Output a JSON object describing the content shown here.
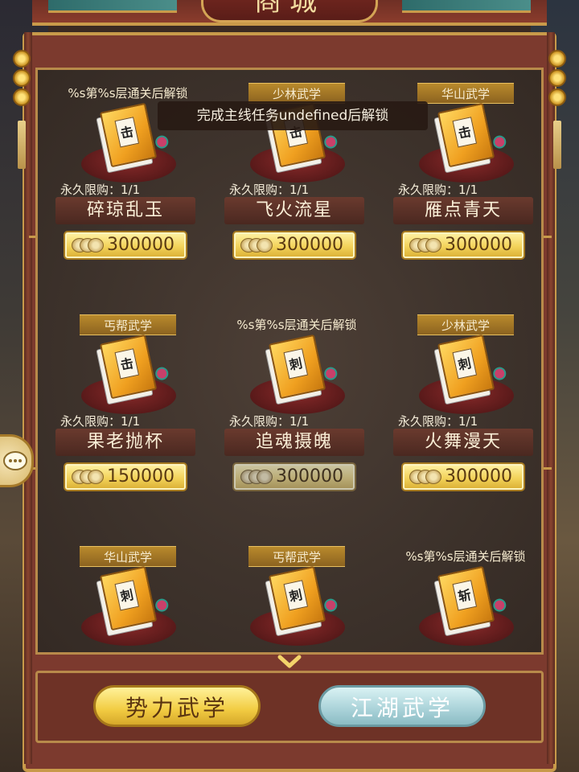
{
  "title": "商城",
  "tooltip": "完成主线任务undefined后解锁",
  "items": [
    {
      "tag": "%s第%s层通关后解锁",
      "tag_style": "plain",
      "book_char": "击",
      "limit": "永久限购：1/1",
      "name": "碎琼乱玉",
      "price": "300000",
      "price_active": true
    },
    {
      "tag": "少林武学",
      "tag_style": "plate",
      "book_char": "击",
      "limit": "永久限购：1/1",
      "name": "飞火流星",
      "price": "300000",
      "price_active": true
    },
    {
      "tag": "华山武学",
      "tag_style": "plate",
      "book_char": "击",
      "limit": "永久限购：1/1",
      "name": "雁点青天",
      "price": "300000",
      "price_active": true
    },
    {
      "tag": "丐帮武学",
      "tag_style": "plate",
      "book_char": "击",
      "limit": "永久限购：1/1",
      "name": "果老抛杯",
      "price": "150000",
      "price_active": true
    },
    {
      "tag": "%s第%s层通关后解锁",
      "tag_style": "plain",
      "book_char": "刺",
      "limit": "永久限购：1/1",
      "name": "追魂摄魄",
      "price": "300000",
      "price_active": false
    },
    {
      "tag": "少林武学",
      "tag_style": "plate",
      "book_char": "刺",
      "limit": "永久限购：1/1",
      "name": "火舞漫天",
      "price": "300000",
      "price_active": true
    },
    {
      "tag": "华山武学",
      "tag_style": "plate",
      "book_char": "刺",
      "limit": "",
      "name": "",
      "price": "",
      "price_active": true
    },
    {
      "tag": "丐帮武学",
      "tag_style": "plate",
      "book_char": "刺",
      "limit": "",
      "name": "",
      "price": "",
      "price_active": true
    },
    {
      "tag": "%s第%s层通关后解锁",
      "tag_style": "plain",
      "book_char": "斩",
      "limit": "",
      "name": "",
      "price": "",
      "price_active": false
    }
  ],
  "tabs": [
    {
      "label": "势力武学",
      "active": true
    },
    {
      "label": "江湖武学",
      "active": false
    }
  ],
  "colors": {
    "panel": "#7c3a2e",
    "gold": "#c89a4a",
    "tab_active": "#f2cc42",
    "tab_inactive": "#a9d2d8"
  },
  "icons": {
    "scroll_down": "chevron-down-icon",
    "chat": "chat-bubble-icon",
    "currency": "coin-stack-icon"
  }
}
